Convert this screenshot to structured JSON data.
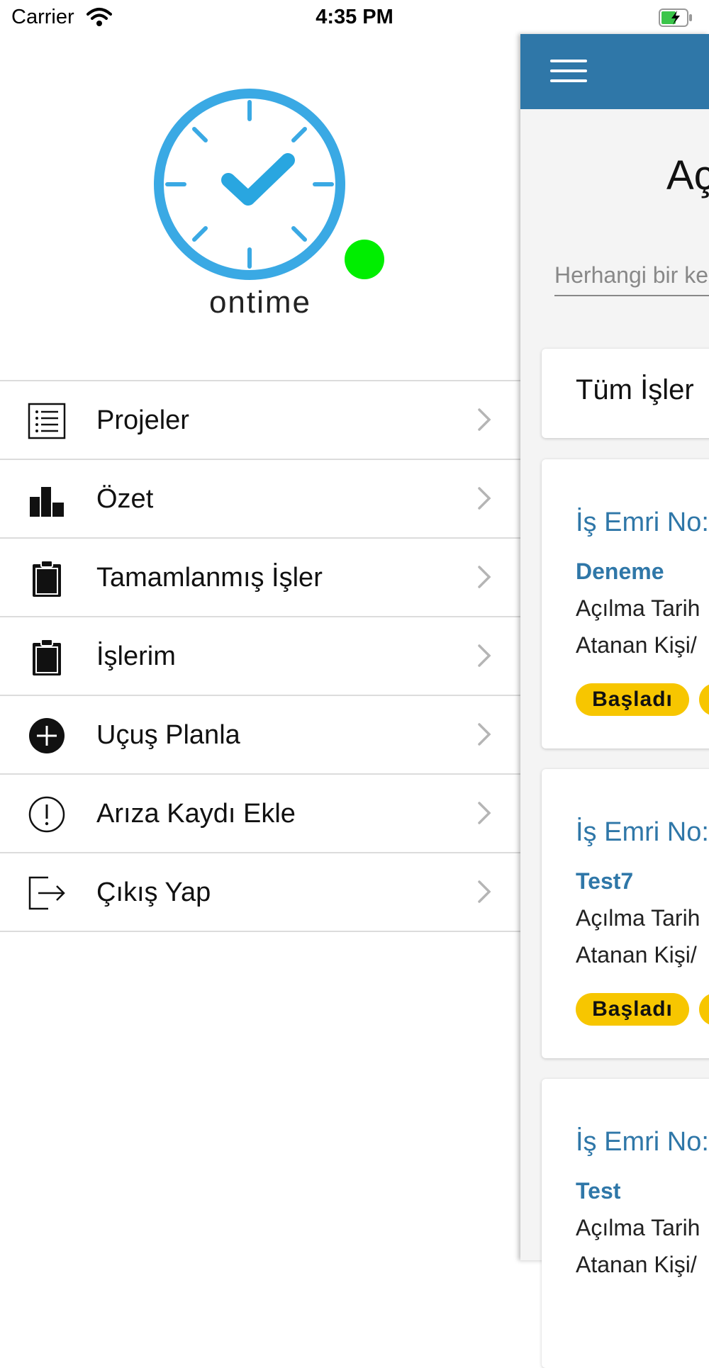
{
  "status_bar": {
    "carrier": "Carrier",
    "time": "4:35 PM"
  },
  "logo": {
    "text": "ontime",
    "status_dot_color": "#00ee00",
    "clock_color": "#3aa9e4"
  },
  "menu": {
    "items": [
      {
        "label": "Projeler",
        "icon": "list-icon"
      },
      {
        "label": "Özet",
        "icon": "bar-chart-icon"
      },
      {
        "label": "Tamamlanmış İşler",
        "icon": "clipboard-icon"
      },
      {
        "label": "İşlerim",
        "icon": "clipboard-icon"
      },
      {
        "label": "Uçuş Planla",
        "icon": "plus-circle-icon"
      },
      {
        "label": "Arıza Kaydı Ekle",
        "icon": "alert-circle-icon"
      },
      {
        "label": "Çıkış Yap",
        "icon": "logout-icon"
      }
    ]
  },
  "main": {
    "topbar_color": "#2f77a8",
    "title": "Aç",
    "search_placeholder": "Herhangi bir ke",
    "filter_label": "Tüm İşler",
    "jobs": [
      {
        "number_label": "İş Emri No:",
        "name": "Deneme",
        "date_label": "Açılma Tarih",
        "assignee_label": "Atanan Kişi/",
        "status": "Başladı"
      },
      {
        "number_label": "İş Emri No:",
        "name": "Test7",
        "date_label": "Açılma Tarih",
        "assignee_label": "Atanan Kişi/",
        "status": "Başladı"
      },
      {
        "number_label": "İş Emri No:",
        "name": "Test",
        "date_label": "Açılma Tarih",
        "assignee_label": "Atanan Kişi/",
        "status": ""
      }
    ]
  }
}
